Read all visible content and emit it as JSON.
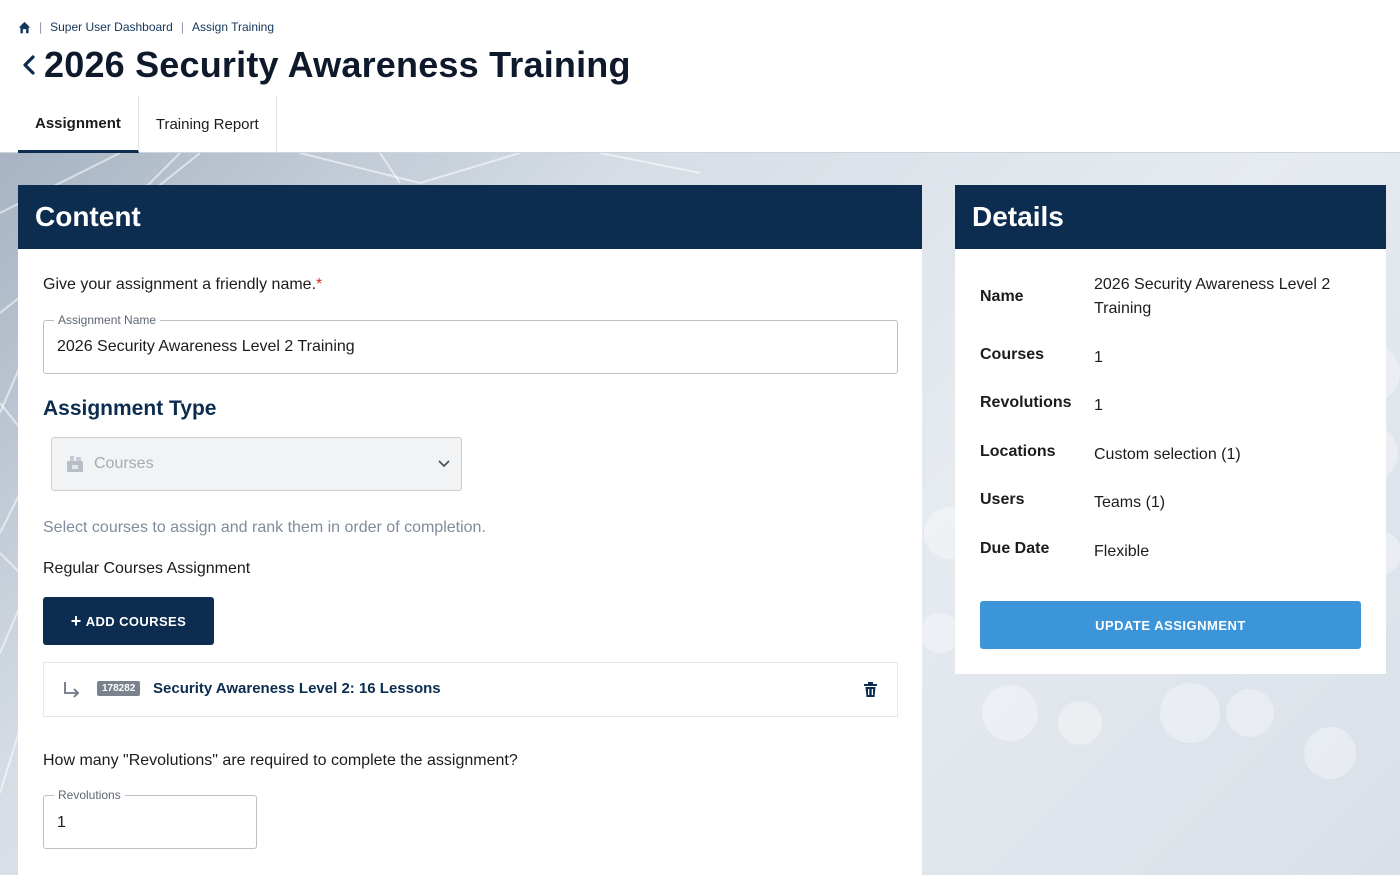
{
  "breadcrumb": {
    "home_icon": "home-icon",
    "items": [
      "Super User Dashboard",
      "Assign Training"
    ]
  },
  "header": {
    "title": "2026 Security Awareness Training",
    "tabs": [
      {
        "label": "Assignment",
        "active": true
      },
      {
        "label": "Training Report",
        "active": false
      }
    ]
  },
  "content": {
    "heading": "Content",
    "name_prompt": "Give your assignment a friendly name.",
    "required_mark": "*",
    "name_field": {
      "legend": "Assignment Name",
      "value": "2026 Security Awareness Level 2 Training"
    },
    "type_heading": "Assignment Type",
    "type_select": {
      "value": "Courses",
      "icon": "courses-icon",
      "disabled": true
    },
    "hint": "Select courses to assign and rank them in order of completion.",
    "regular_label": "Regular Courses Assignment",
    "add_button": "ADD COURSES",
    "courses": [
      {
        "id": "178282",
        "name": "Security Awareness Level 2: 16 Lessons"
      }
    ],
    "revolutions_prompt": "How many \"Revolutions\" are required to complete the assignment?",
    "revolutions_field": {
      "legend": "Revolutions",
      "value": "1"
    }
  },
  "details": {
    "heading": "Details",
    "rows": [
      {
        "label": "Name",
        "value": "2026 Security Awareness Level 2 Training"
      },
      {
        "label": "Courses",
        "value": "1"
      },
      {
        "label": "Revolutions",
        "value": "1"
      },
      {
        "label": "Locations",
        "value": "Custom selection (1)"
      },
      {
        "label": "Users",
        "value": "Teams (1)"
      },
      {
        "label": "Due Date",
        "value": "Flexible"
      }
    ],
    "update_button": "UPDATE ASSIGNMENT"
  },
  "colors": {
    "navy": "#0c2d4f",
    "accent_blue": "#3c95d9",
    "required": "#d0312d",
    "hint": "#7f8c9b"
  }
}
